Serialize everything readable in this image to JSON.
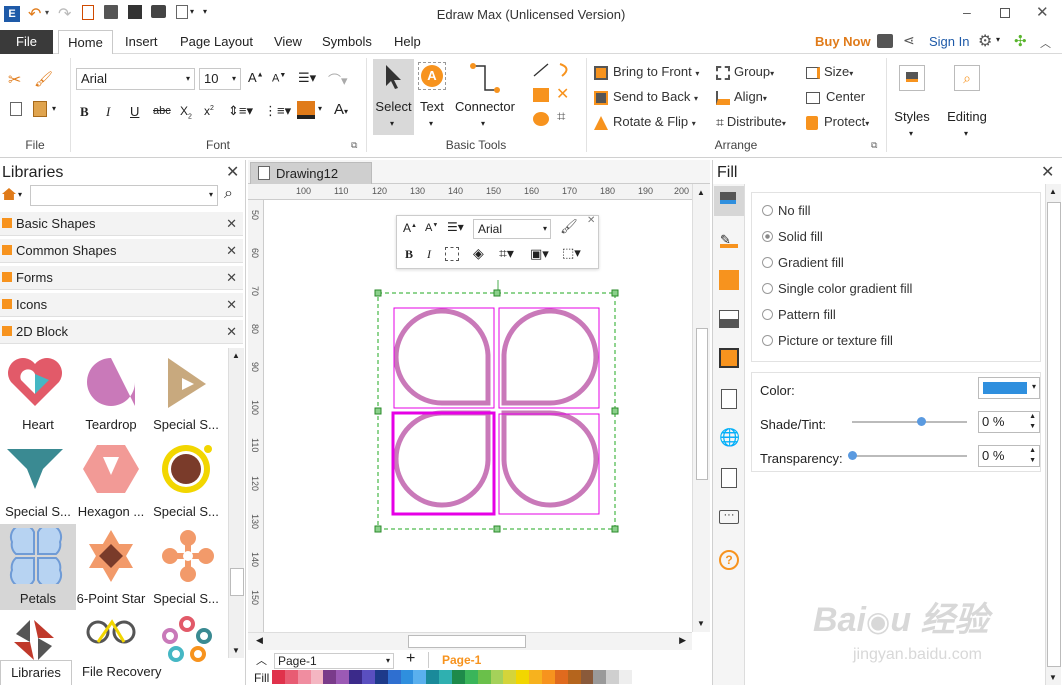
{
  "app": {
    "title": "Edraw Max (Unlicensed Version)"
  },
  "tabs": [
    "File",
    "Home",
    "Insert",
    "Page Layout",
    "View",
    "Symbols",
    "Help"
  ],
  "account": {
    "buy_now": "Buy Now",
    "sign_in": "Sign In"
  },
  "ribbon": {
    "font": {
      "family": "Arial",
      "size": "10",
      "group": "Font"
    },
    "file_group": "File",
    "basic_tools": {
      "select": "Select",
      "text": "Text",
      "connector": "Connector",
      "group": "Basic Tools"
    },
    "arrange": {
      "bring_to_front": "Bring to Front",
      "send_to_back": "Send to Back",
      "rotate_flip": "Rotate & Flip",
      "group": "Group",
      "align": "Align",
      "distribute": "Distribute",
      "size": "Size",
      "center": "Center",
      "protect": "Protect",
      "label": "Arrange"
    },
    "styles": "Styles",
    "editing": "Editing"
  },
  "libraries": {
    "title": "Libraries",
    "categories": [
      "Basic Shapes",
      "Common Shapes",
      "Forms",
      "Icons",
      "2D Block"
    ],
    "shapes": [
      {
        "label": "Heart"
      },
      {
        "label": "Teardrop"
      },
      {
        "label": "Special S..."
      },
      {
        "label": "Special S..."
      },
      {
        "label": "Hexagon ..."
      },
      {
        "label": "Special S..."
      },
      {
        "label": "Petals"
      },
      {
        "label": "6-Point Star"
      },
      {
        "label": "Special S..."
      }
    ],
    "bottom_tabs": [
      "Libraries",
      "File Recovery"
    ]
  },
  "document": {
    "tab": "Drawing12",
    "ruler_h": [
      "100",
      "110",
      "120",
      "130",
      "140",
      "150",
      "160",
      "170",
      "180",
      "190",
      "200"
    ],
    "ruler_v": [
      "50",
      "60",
      "70",
      "80",
      "90",
      "100",
      "110",
      "120",
      "130",
      "140",
      "150"
    ]
  },
  "floating_toolbar": {
    "font": "Arial"
  },
  "page": {
    "current": "Page-1",
    "tab": "Page-1"
  },
  "bottom": {
    "fill_label": "Fill"
  },
  "fill_panel": {
    "title": "Fill",
    "options": [
      {
        "label": "No fill",
        "selected": false
      },
      {
        "label": "Solid fill",
        "selected": true
      },
      {
        "label": "Gradient fill",
        "selected": false
      },
      {
        "label": "Single color gradient fill",
        "selected": false
      },
      {
        "label": "Pattern fill",
        "selected": false
      },
      {
        "label": "Picture or texture fill",
        "selected": false
      }
    ],
    "color_label": "Color:",
    "color_value": "#2f8fde",
    "shade_label": "Shade/Tint:",
    "shade_value": "0 %",
    "shade_level": 0.6,
    "transparency_label": "Transparency:",
    "transparency_value": "0 %",
    "transparency_level": 0
  },
  "colors": {
    "accent": "#c0392b",
    "petal": "#c979b9",
    "selection": "#e600e6",
    "sidebar_blue": "#2f8fde",
    "orange": "#f7931e"
  }
}
